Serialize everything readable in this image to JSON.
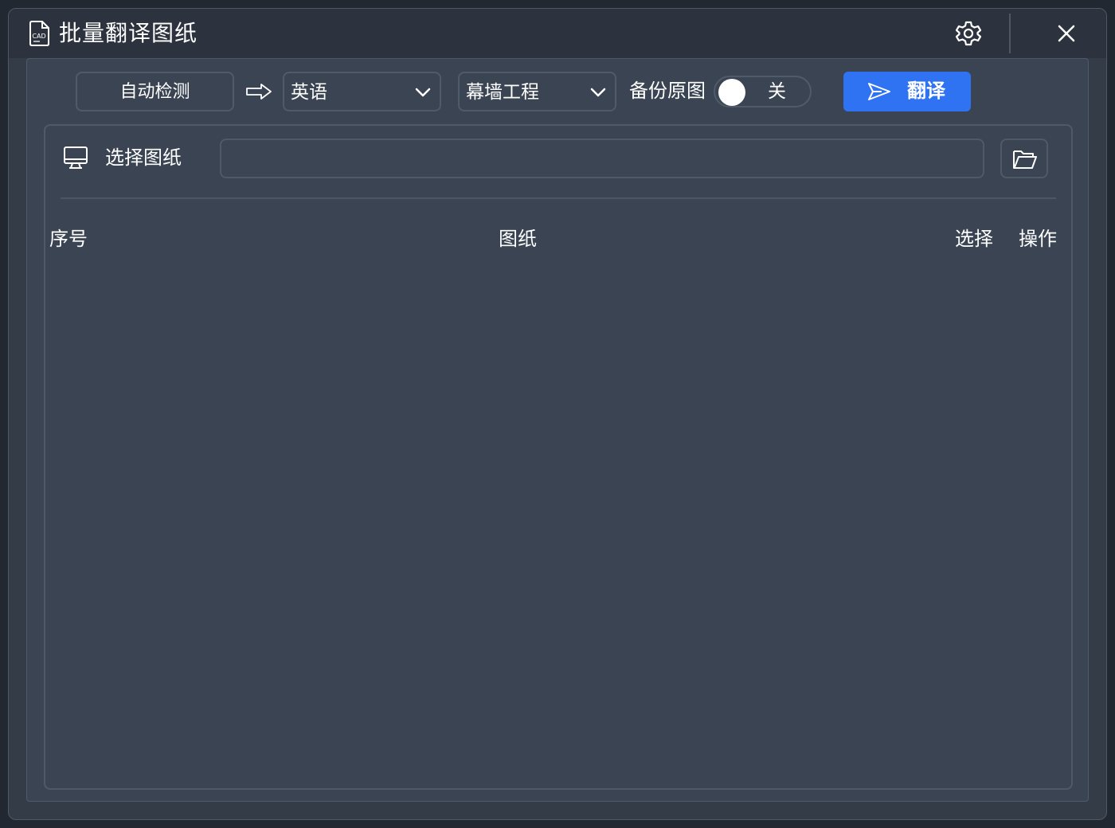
{
  "window": {
    "title": "批量翻译图纸",
    "icon": "cad-file-icon"
  },
  "titlebar": {
    "settings_icon": "gear-icon",
    "close_icon": "close-icon"
  },
  "toolbar": {
    "source_language": "自动检测",
    "arrow_icon": "arrow-right-icon",
    "target_language": "英语",
    "domain": "幕墙工程",
    "backup_label": "备份原图",
    "backup_toggle_state": "关",
    "translate_label": "翻译",
    "accent_color": "#2f73f2"
  },
  "file_picker": {
    "label": "选择图纸",
    "path_value": "",
    "monitor_icon": "monitor-icon",
    "folder_icon": "folder-open-icon"
  },
  "table": {
    "columns": [
      "序号",
      "图纸",
      "选择",
      "操作"
    ],
    "rows": []
  }
}
